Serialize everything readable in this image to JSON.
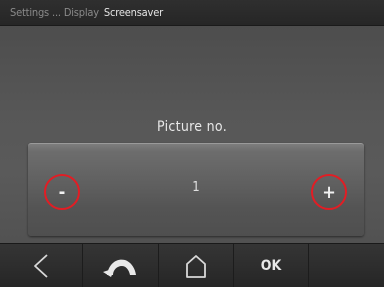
{
  "breadcrumb": {
    "level1": "Settings",
    "separator": "...",
    "level2": "Display",
    "current": "Screensaver"
  },
  "setting": {
    "label": "Picture no.",
    "value": "1",
    "minus_label": "-",
    "plus_label": "+"
  },
  "toolbar": {
    "back_icon": "back-triangle-icon",
    "undo_icon": "undo-arrow-icon",
    "home_icon": "home-icon",
    "ok_label": "OK"
  },
  "colors": {
    "highlight_ring": "#e21d24",
    "background": "#555555"
  }
}
